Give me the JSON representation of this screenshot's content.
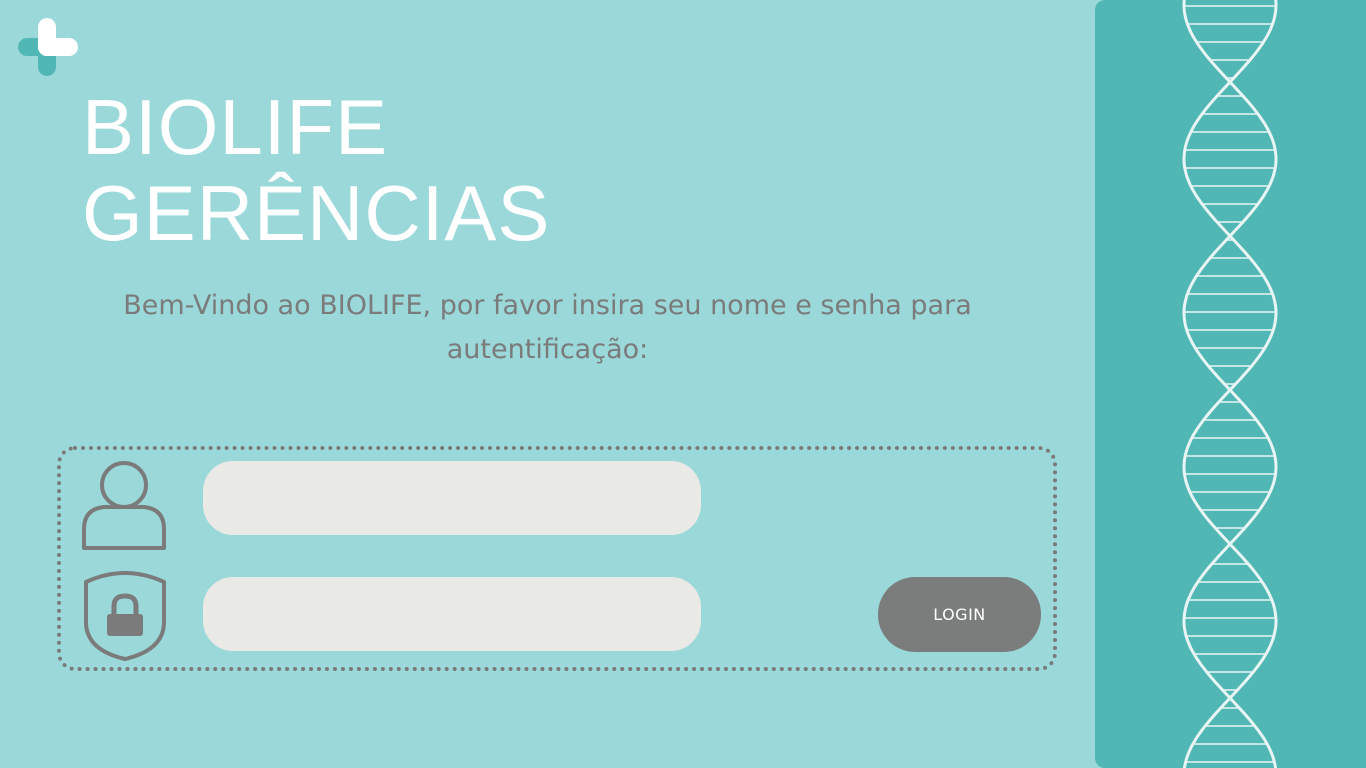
{
  "brand": {
    "line1": "BIOLIFE",
    "line2": "GERÊNCIAS"
  },
  "welcome": {
    "text": "Bem-Vindo ao BIOLIFE, por favor insira seu nome e senha para autentificação:"
  },
  "form": {
    "username_value": "",
    "password_value": "",
    "login_label": "LOGIN"
  },
  "icons": {
    "logo": "plus-cross-icon",
    "user": "user-icon",
    "lock": "shield-lock-icon",
    "decoration": "dna-helix-icon"
  },
  "colors": {
    "background": "#9ad8d9",
    "side_panel": "#51b7b5",
    "field_bg": "#e9e9e6",
    "button_bg": "#7b7d7d",
    "text_gray": "#7b7b7b",
    "logo_dark": "#51b7b5",
    "white": "#ffffff"
  }
}
